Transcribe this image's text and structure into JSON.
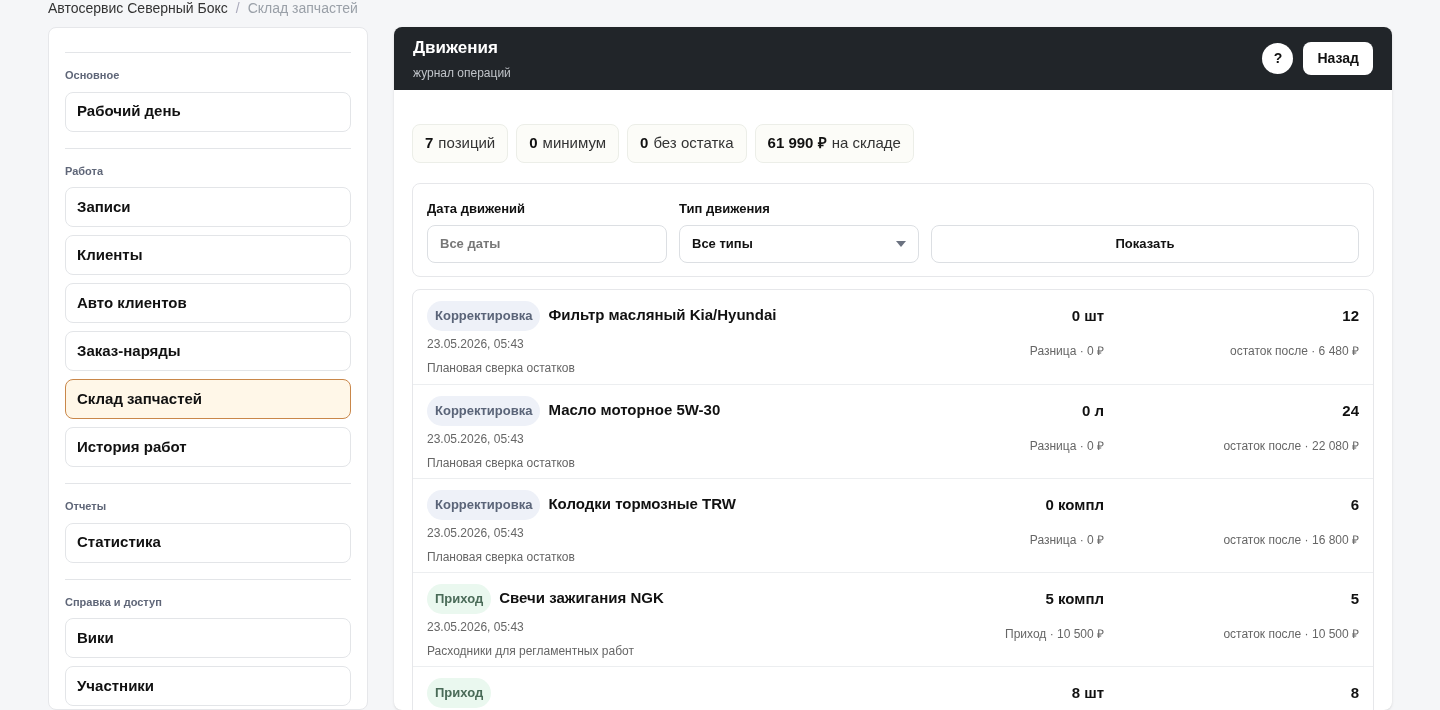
{
  "breadcrumb": [
    "Автосервис Северный Бокс",
    "Склад запчастей"
  ],
  "breadcrumb_separator": "/",
  "sidebar": {
    "sections": [
      {
        "title": "Основное",
        "items": [
          {
            "label": "Рабочий день",
            "selected": false
          }
        ]
      },
      {
        "title": "Работа",
        "items": [
          {
            "label": "Записи",
            "selected": false
          },
          {
            "label": "Клиенты",
            "selected": false
          },
          {
            "label": "Авто клиентов",
            "selected": false
          },
          {
            "label": "Заказ-наряды",
            "selected": false
          },
          {
            "label": "Склад запчастей",
            "selected": true
          },
          {
            "label": "История работ",
            "selected": false
          }
        ]
      },
      {
        "title": "Отчеты",
        "items": [
          {
            "label": "Статистика",
            "selected": false
          }
        ]
      },
      {
        "title": "Справка и доступ",
        "items": [
          {
            "label": "Вики",
            "selected": false
          },
          {
            "label": "Участники",
            "selected": false
          }
        ]
      }
    ]
  },
  "header": {
    "title": "Движения",
    "subtitle": "журнал операций",
    "help": "?",
    "back": "Назад"
  },
  "stats": [
    {
      "value": "7",
      "label": "позиций"
    },
    {
      "value": "0",
      "label": "минимум"
    },
    {
      "value": "0",
      "label": "без остатка"
    },
    {
      "value": "61 990 ₽",
      "label": "на складе"
    }
  ],
  "filters": {
    "date_label": "Дата движений",
    "date_placeholder": "Все даты",
    "type_label": "Тип движения",
    "type_value": "Все типы",
    "show": "Показать"
  },
  "movements": [
    {
      "kind": "adjustment",
      "badge": "Корректировка",
      "name": "Фильтр масляный Kia/Hyundai",
      "date": "23.05.2026, 05:43",
      "note": "Плановая сверка остатков",
      "qty": "0 шт",
      "delta": "Разница · 0 ₽",
      "balance": "12",
      "after": "остаток после · 6 480 ₽"
    },
    {
      "kind": "adjustment",
      "badge": "Корректировка",
      "name": "Масло моторное 5W-30",
      "date": "23.05.2026, 05:43",
      "note": "Плановая сверка остатков",
      "qty": "0 л",
      "delta": "Разница · 0 ₽",
      "balance": "24",
      "after": "остаток после · 22 080 ₽"
    },
    {
      "kind": "adjustment",
      "badge": "Корректировка",
      "name": "Колодки тормозные TRW",
      "date": "23.05.2026, 05:43",
      "note": "Плановая сверка остатков",
      "qty": "0 компл",
      "delta": "Разница · 0 ₽",
      "balance": "6",
      "after": "остаток после · 16 800 ₽"
    },
    {
      "kind": "income",
      "badge": "Приход",
      "name": "Свечи зажигания NGK",
      "date": "23.05.2026, 05:43",
      "note": "Расходники для регламентных работ",
      "qty": "5 компл",
      "delta": "Приход · 10 500 ₽",
      "balance": "5",
      "after": "остаток после · 10 500 ₽"
    },
    {
      "kind": "income",
      "badge": "Приход",
      "qty": "8 шт",
      "balance": "8"
    }
  ]
}
